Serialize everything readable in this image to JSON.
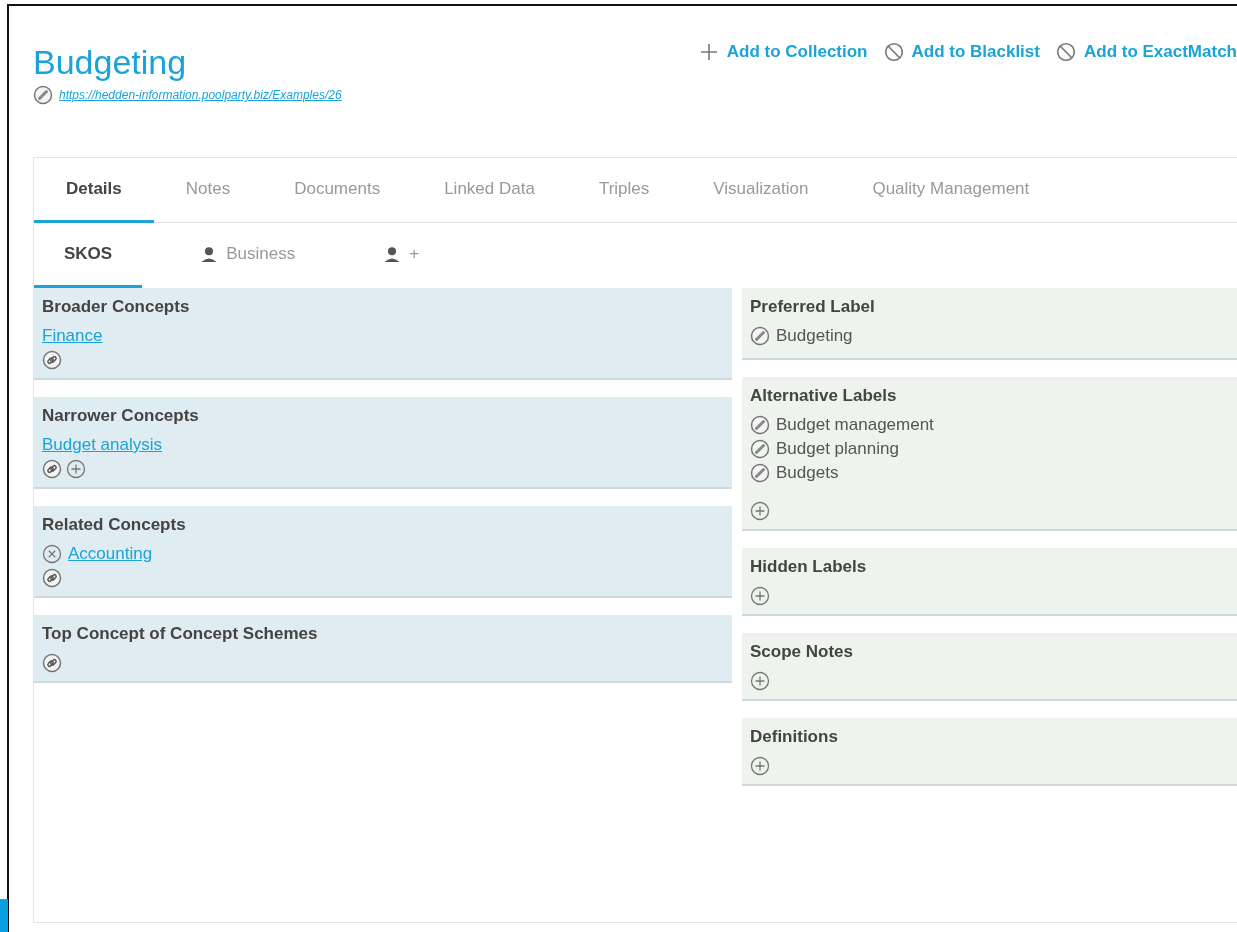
{
  "concept": {
    "title": "Budgeting",
    "uri": "https://hedden-information.poolparty.biz/Examples/26"
  },
  "actions": [
    {
      "kind": "add",
      "label": "Add to Collection"
    },
    {
      "kind": "block",
      "label": "Add to Blacklist"
    },
    {
      "kind": "block",
      "label": "Add to ExactMatch"
    }
  ],
  "tabs": [
    {
      "label": "Details",
      "selected": true
    },
    {
      "label": "Notes",
      "selected": false
    },
    {
      "label": "Documents",
      "selected": false
    },
    {
      "label": "Linked Data",
      "selected": false
    },
    {
      "label": "Triples",
      "selected": false
    },
    {
      "label": "Visualization",
      "selected": false
    },
    {
      "label": "Quality Management",
      "selected": false
    }
  ],
  "subtabs": [
    {
      "kind": "plain",
      "label": "SKOS",
      "selected": true
    },
    {
      "kind": "person",
      "label": "Business",
      "selected": false
    },
    {
      "kind": "person",
      "label": "+",
      "selected": false
    }
  ],
  "relations": [
    {
      "title": "Broader Concepts",
      "items": [
        {
          "kind": "link",
          "text": "Finance"
        }
      ],
      "link_tool": true
    },
    {
      "title": "Narrower Concepts",
      "items": [
        {
          "kind": "link",
          "text": "Budget analysis"
        }
      ],
      "link_tool": true,
      "add_tool": true
    },
    {
      "title": "Related Concepts",
      "items": [
        {
          "kind": "removable",
          "text": "Accounting"
        }
      ],
      "link_tool": true
    },
    {
      "title": "Top Concept of Concept Schemes",
      "link_tool": true
    }
  ],
  "labels": [
    {
      "title": "Preferred Label",
      "values": [
        "Budgeting"
      ]
    },
    {
      "title": "Alternative Labels",
      "values": [
        "Budget management",
        "Budget planning",
        "Budgets"
      ],
      "add_tool": true
    },
    {
      "title": "Hidden Labels",
      "add_tool": true
    },
    {
      "title": "Scope Notes",
      "add_tool": true
    },
    {
      "title": "Definitions",
      "add_tool": true
    }
  ]
}
